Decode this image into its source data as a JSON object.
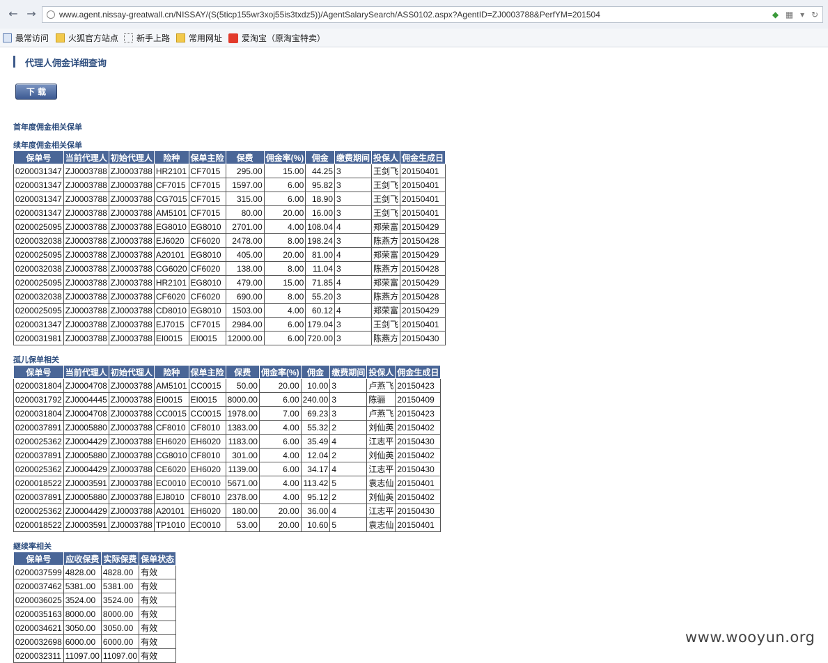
{
  "browser": {
    "url": "www.agent.nissay-greatwall.cn/NISSAY/(S(5ticp155wr3xoj55is3txdz5))/AgentSalarySearch/ASS0102.aspx?AgentID=ZJ0003788&PerfYM=201504",
    "bookmarks": [
      {
        "label": "最常访问",
        "icon": "frequent-icon"
      },
      {
        "label": "火狐官方站点",
        "icon": "folder-icon"
      },
      {
        "label": "新手上路",
        "icon": "dotted-folder-icon"
      },
      {
        "label": "常用网址",
        "icon": "folder-icon"
      },
      {
        "label": "爱淘宝（原淘宝特卖）",
        "icon": "taobao-icon"
      }
    ]
  },
  "page": {
    "title": "代理人佣金详细查询",
    "download_label": "下 载"
  },
  "sections": {
    "first_year": "首年度佣金相关保单",
    "renewal": "续年度佣金相关保单",
    "orphan": "孤儿保单相关",
    "persistency": "継续率相关"
  },
  "renewal_table": {
    "headers": [
      "保单号",
      "当前代理人",
      "初始代理人",
      "险种",
      "保单主险",
      "保费",
      "佣金率(%)",
      "佣金",
      "缴费期间",
      "投保人",
      "佣金生成日"
    ],
    "rows": [
      [
        "0200031347",
        "ZJ0003788",
        "ZJ0003788",
        "HR2101",
        "CF7015",
        "295.00",
        "15.00",
        "44.25",
        "3",
        "王剑飞",
        "20150401"
      ],
      [
        "0200031347",
        "ZJ0003788",
        "ZJ0003788",
        "CF7015",
        "CF7015",
        "1597.00",
        "6.00",
        "95.82",
        "3",
        "王剑飞",
        "20150401"
      ],
      [
        "0200031347",
        "ZJ0003788",
        "ZJ0003788",
        "CG7015",
        "CF7015",
        "315.00",
        "6.00",
        "18.90",
        "3",
        "王剑飞",
        "20150401"
      ],
      [
        "0200031347",
        "ZJ0003788",
        "ZJ0003788",
        "AM5101",
        "CF7015",
        "80.00",
        "20.00",
        "16.00",
        "3",
        "王剑飞",
        "20150401"
      ],
      [
        "0200025095",
        "ZJ0003788",
        "ZJ0003788",
        "EG8010",
        "EG8010",
        "2701.00",
        "4.00",
        "108.04",
        "4",
        "郑荣富",
        "20150429"
      ],
      [
        "0200032038",
        "ZJ0003788",
        "ZJ0003788",
        "EJ6020",
        "CF6020",
        "2478.00",
        "8.00",
        "198.24",
        "3",
        "陈燕方",
        "20150428"
      ],
      [
        "0200025095",
        "ZJ0003788",
        "ZJ0003788",
        "A20101",
        "EG8010",
        "405.00",
        "20.00",
        "81.00",
        "4",
        "郑荣富",
        "20150429"
      ],
      [
        "0200032038",
        "ZJ0003788",
        "ZJ0003788",
        "CG6020",
        "CF6020",
        "138.00",
        "8.00",
        "11.04",
        "3",
        "陈燕方",
        "20150428"
      ],
      [
        "0200025095",
        "ZJ0003788",
        "ZJ0003788",
        "HR2101",
        "EG8010",
        "479.00",
        "15.00",
        "71.85",
        "4",
        "郑荣富",
        "20150429"
      ],
      [
        "0200032038",
        "ZJ0003788",
        "ZJ0003788",
        "CF6020",
        "CF6020",
        "690.00",
        "8.00",
        "55.20",
        "3",
        "陈燕方",
        "20150428"
      ],
      [
        "0200025095",
        "ZJ0003788",
        "ZJ0003788",
        "CD8010",
        "EG8010",
        "1503.00",
        "4.00",
        "60.12",
        "4",
        "郑荣富",
        "20150429"
      ],
      [
        "0200031347",
        "ZJ0003788",
        "ZJ0003788",
        "EJ7015",
        "CF7015",
        "2984.00",
        "6.00",
        "179.04",
        "3",
        "王剑飞",
        "20150401"
      ],
      [
        "0200031981",
        "ZJ0003788",
        "ZJ0003788",
        "EI0015",
        "EI0015",
        "12000.00",
        "6.00",
        "720.00",
        "3",
        "陈燕方",
        "20150430"
      ]
    ]
  },
  "orphan_table": {
    "headers": [
      "保单号",
      "当前代理人",
      "初始代理人",
      "险种",
      "保单主险",
      "保费",
      "佣金率(%)",
      "佣金",
      "缴费期间",
      "投保人",
      "佣金生成日"
    ],
    "rows": [
      [
        "0200031804",
        "ZJ0004708",
        "ZJ0003788",
        "AM5101",
        "CC0015",
        "50.00",
        "20.00",
        "10.00",
        "3",
        "卢燕飞",
        "20150423"
      ],
      [
        "0200031792",
        "ZJ0004445",
        "ZJ0003788",
        "EI0015",
        "EI0015",
        "8000.00",
        "6.00",
        "240.00",
        "3",
        "陈骊",
        "20150409"
      ],
      [
        "0200031804",
        "ZJ0004708",
        "ZJ0003788",
        "CC0015",
        "CC0015",
        "1978.00",
        "7.00",
        "69.23",
        "3",
        "卢燕飞",
        "20150423"
      ],
      [
        "0200037891",
        "ZJ0005880",
        "ZJ0003788",
        "CF8010",
        "CF8010",
        "1383.00",
        "4.00",
        "55.32",
        "2",
        "刘仙英",
        "20150402"
      ],
      [
        "0200025362",
        "ZJ0004429",
        "ZJ0003788",
        "EH6020",
        "EH6020",
        "1183.00",
        "6.00",
        "35.49",
        "4",
        "江志平",
        "20150430"
      ],
      [
        "0200037891",
        "ZJ0005880",
        "ZJ0003788",
        "CG8010",
        "CF8010",
        "301.00",
        "4.00",
        "12.04",
        "2",
        "刘仙英",
        "20150402"
      ],
      [
        "0200025362",
        "ZJ0004429",
        "ZJ0003788",
        "CE6020",
        "EH6020",
        "1139.00",
        "6.00",
        "34.17",
        "4",
        "江志平",
        "20150430"
      ],
      [
        "0200018522",
        "ZJ0003591",
        "ZJ0003788",
        "EC0010",
        "EC0010",
        "5671.00",
        "4.00",
        "113.42",
        "5",
        "袁志仙",
        "20150401"
      ],
      [
        "0200037891",
        "ZJ0005880",
        "ZJ0003788",
        "EJ8010",
        "CF8010",
        "2378.00",
        "4.00",
        "95.12",
        "2",
        "刘仙英",
        "20150402"
      ],
      [
        "0200025362",
        "ZJ0004429",
        "ZJ0003788",
        "A20101",
        "EH6020",
        "180.00",
        "20.00",
        "36.00",
        "4",
        "江志平",
        "20150430"
      ],
      [
        "0200018522",
        "ZJ0003591",
        "ZJ0003788",
        "TP1010",
        "EC0010",
        "53.00",
        "20.00",
        "10.60",
        "5",
        "袁志仙",
        "20150401"
      ]
    ]
  },
  "persistency_table": {
    "headers": [
      "保单号",
      "应收保费",
      "实际保费",
      "保单状态"
    ],
    "rows": [
      [
        "0200037599",
        "4828.00",
        "4828.00",
        "有效"
      ],
      [
        "0200037462",
        "5381.00",
        "5381.00",
        "有效"
      ],
      [
        "0200036025",
        "3524.00",
        "3524.00",
        "有效"
      ],
      [
        "0200035163",
        "8000.00",
        "8000.00",
        "有效"
      ],
      [
        "0200034621",
        "3050.00",
        "3050.00",
        "有效"
      ],
      [
        "0200032698",
        "6000.00",
        "6000.00",
        "有效"
      ],
      [
        "0200032311",
        "11097.00",
        "11097.00",
        "有效"
      ]
    ]
  },
  "watermark": "www.wooyun.org"
}
